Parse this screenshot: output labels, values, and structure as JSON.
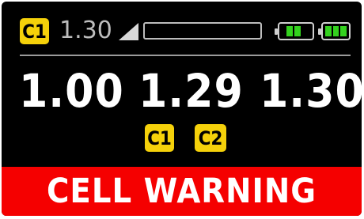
{
  "status": {
    "active_cell_badge": "C1",
    "value": "1.30",
    "icons": {
      "signal": "signal-strength-icon",
      "battery_left": "battery-icon",
      "battery_right": "battery-icon"
    },
    "battery_left_level": 0.67,
    "battery_right_level": 1.0
  },
  "cells": {
    "values": [
      "1.00",
      "1.29",
      "1.30"
    ]
  },
  "badges": {
    "c1": "C1",
    "c2": "C2"
  },
  "warning": {
    "text": "CELL WARNING"
  },
  "colors": {
    "badge": "#f5d10a",
    "warning": "#f50000",
    "battery_fill": "#33d11e",
    "background": "#000000"
  }
}
